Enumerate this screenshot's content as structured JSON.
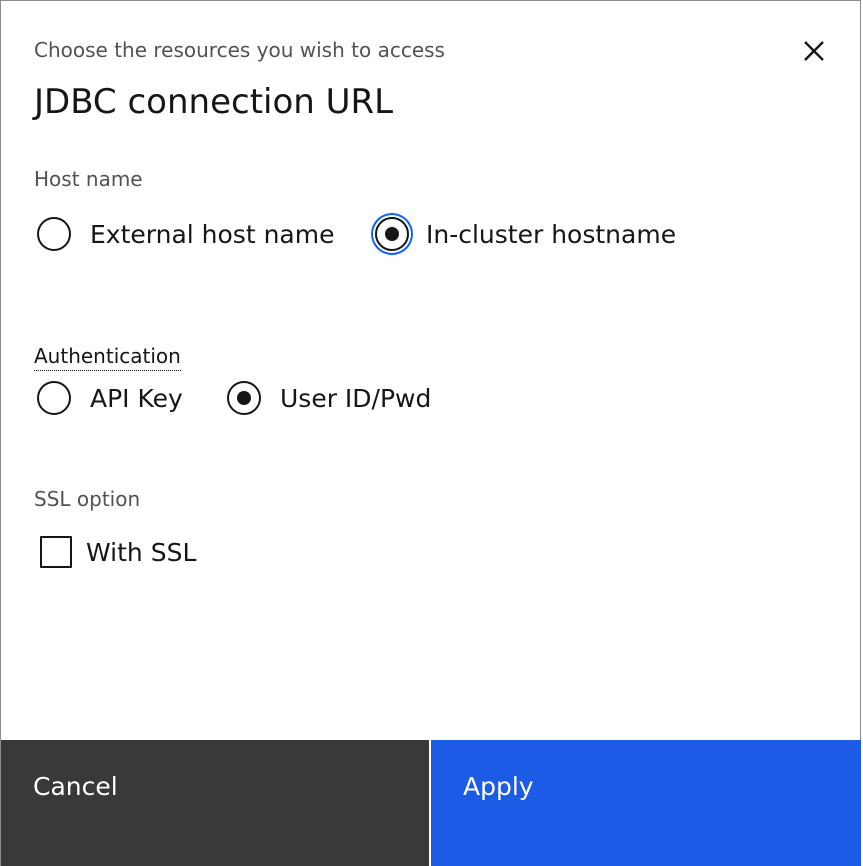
{
  "header": {
    "subtitle": "Choose the resources you wish to access",
    "title": "JDBC connection URL",
    "close_icon": "close-icon"
  },
  "host_name": {
    "label": "Host name",
    "options": [
      {
        "label": "External host name",
        "selected": false
      },
      {
        "label": "In-cluster hostname",
        "selected": true
      }
    ]
  },
  "authentication": {
    "label": "Authentication",
    "options": [
      {
        "label": "API Key",
        "selected": false
      },
      {
        "label": "User ID/Pwd",
        "selected": true
      }
    ]
  },
  "ssl": {
    "label": "SSL option",
    "checkbox_label": "With SSL",
    "checked": false
  },
  "footer": {
    "cancel_label": "Cancel",
    "apply_label": "Apply"
  },
  "colors": {
    "primary": "#1b5be6",
    "secondary": "#393939",
    "focus": "#0f62fe",
    "text": "#161616",
    "muted_text": "#525252"
  }
}
